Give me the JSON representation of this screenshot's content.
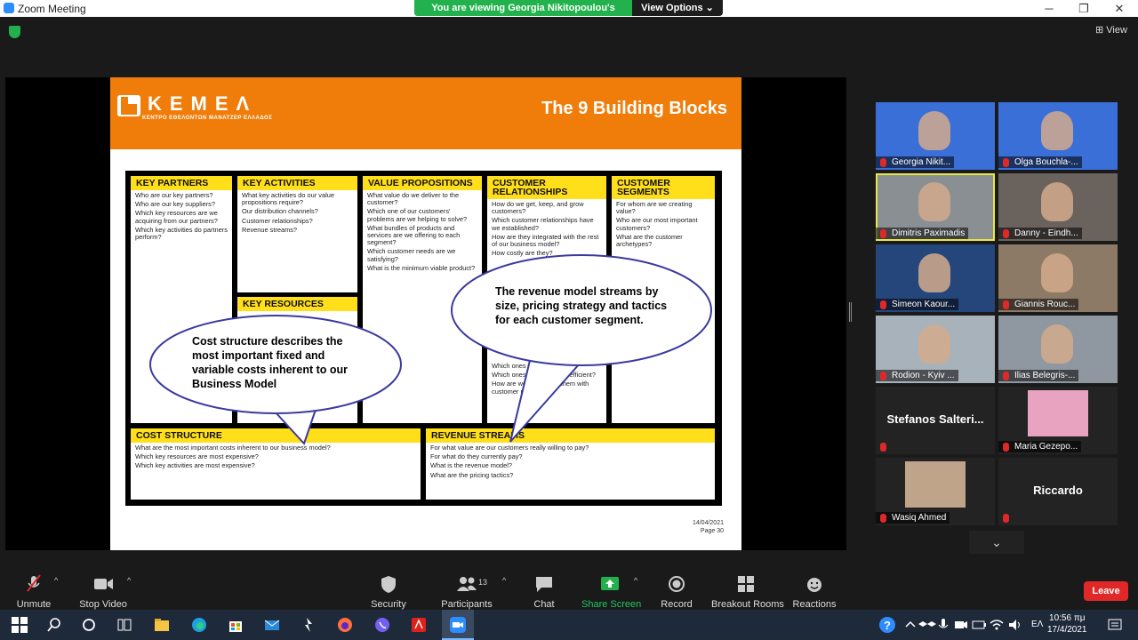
{
  "window": {
    "title": "Zoom Meeting",
    "minimize": "─",
    "maximize": "❐",
    "close": "✕"
  },
  "banner": {
    "viewing": "You are viewing Georgia Nikitopoulou's screen",
    "options": "View Options ⌄"
  },
  "view_button": "⊞ View",
  "slide": {
    "logo": "KEMEA",
    "logo_display": "ΚΕΜΕΛ",
    "logo_sub": "ΚΕΝΤΡΟ ΕΘΕΛΟΝΤΩΝ ΜΑΝΑΤΖΕΡ ΕΛΛΑΔΟΣ",
    "title": "The 9 Building Blocks",
    "blocks": {
      "key_partners": {
        "title": "KEY PARTNERS",
        "q": [
          "Who are our key partners?",
          "Who are our key suppliers?",
          "Which key resources are we acquiring from our partners?",
          "Which key activities do partners perform?"
        ]
      },
      "key_activities": {
        "title": "KEY ACTIVITIES",
        "q": [
          "What key activities do our value propositions require?",
          "Our distribution channels?",
          "Customer relationships?",
          "Revenue streams?"
        ]
      },
      "key_resources": {
        "title": "KEY RESOURCES"
      },
      "value_propositions": {
        "title": "VALUE PROPOSITIONS",
        "q": [
          "What value do we deliver to the customer?",
          "Which one of our customers' problems are we helping to solve?",
          "What bundles of products and services are we offering to each segment?",
          "Which customer needs are we satisfying?",
          "What is the minimum viable product?"
        ]
      },
      "customer_relationships": {
        "title": "CUSTOMER RELATIONSHIPS",
        "q": [
          "How do we get, keep, and grow customers?",
          "Which customer relationships have we established?",
          "How are they integrated with the rest of our business model?",
          "How costly are they?"
        ],
        "lower": [
          "Which ones work best?",
          "Which ones are most cost-efficient?",
          "How are we integrating them with customer routines?"
        ]
      },
      "customer_segments": {
        "title": "CUSTOMER SEGMENTS",
        "q": [
          "For whom are we creating value?",
          "Who are our most important customers?",
          "What are the customer archetypes?"
        ]
      },
      "cost_structure": {
        "title": "COST STRUCTURE",
        "q": [
          "What are the most important costs inherent to our business model?",
          "Which key resources are most expensive?",
          "Which key activities are most expensive?"
        ]
      },
      "revenue_streams": {
        "title": "REVENUE STREAMS",
        "q": [
          "For what value are our customers really willing to pay?",
          "For what do they currently pay?",
          "What is the revenue model?",
          "What are the pricing tactics?"
        ]
      }
    },
    "callout_cost": "Cost structure describes the most important fixed and variable costs inherent to our Business Model",
    "callout_revenue": "The revenue model streams by size, pricing strategy and tactics for each customer segment.",
    "date": "14/04/2021",
    "page": "Page 30"
  },
  "participants": [
    {
      "name": "Georgia Nikit...",
      "bg": "#3a6fd8"
    },
    {
      "name": "Olga Bouchla-...",
      "bg": "#3a6fd8"
    },
    {
      "name": "Dimitris Paximadis",
      "bg": "#8a8f94",
      "active": true
    },
    {
      "name": "Danny - Eindh...",
      "bg": "#6a625c"
    },
    {
      "name": "Simeon Kaour...",
      "bg": "#24467a"
    },
    {
      "name": "Giannis Rouc...",
      "bg": "#8c7a66"
    },
    {
      "name": "Rodion - Kyiv ...",
      "bg": "#a8b2ba"
    },
    {
      "name": "Ilias Belegris-...",
      "bg": "#8f98a0"
    },
    {
      "name": "Stefanos  Salteri...",
      "bg": "#232323",
      "text_only": true
    },
    {
      "name": "Maria Gezepo...",
      "bg": "#232323",
      "thumb": "#e7a3c0"
    },
    {
      "name": "Wasiq Ahmed",
      "bg": "#232323",
      "thumb": "#bfa48a"
    },
    {
      "name": "Riccardo",
      "bg": "#232323",
      "text_only": true
    }
  ],
  "toolbar": {
    "unmute": "Unmute",
    "stop_video": "Stop Video",
    "security": "Security",
    "participants": "Participants",
    "participants_count": "13",
    "chat": "Chat",
    "share_screen": "Share Screen",
    "record": "Record",
    "breakout_rooms": "Breakout Rooms",
    "reactions": "Reactions",
    "leave": "Leave",
    "caret": "^"
  },
  "taskbar": {
    "lang": "ΕΛ",
    "time": "10:56 πμ",
    "date": "17/4/2021"
  },
  "colors": {
    "zoom_blue": "#2d8cff",
    "green": "#22b14c",
    "leave_red": "#e02828",
    "slide_orange": "#f07d0a",
    "bmc_yellow": "#ffde1a"
  }
}
